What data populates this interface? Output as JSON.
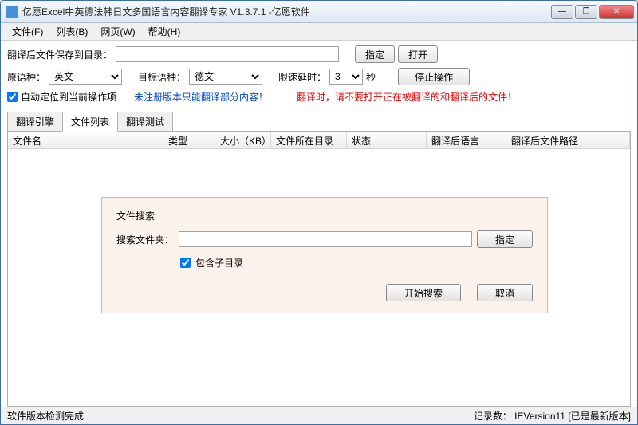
{
  "title": "亿愿Excel中英德法韩日文多国语言内容翻译专家 V1.3.7.1 -亿愿软件",
  "menu": {
    "file": "文件(F)",
    "list": "列表(B)",
    "web": "网页(W)",
    "help": "帮助(H)"
  },
  "saveDir": {
    "label": "翻译后文件保存到目录：",
    "value": "",
    "specify": "指定",
    "open": "打开"
  },
  "lang": {
    "srcLabel": "原语种：",
    "srcValue": "英文",
    "tgtLabel": "目标语种：",
    "tgtValue": "德文",
    "delayLabel": "限速延时：",
    "delayValue": "3",
    "delayUnit": "秒",
    "stop": "停止操作"
  },
  "opts": {
    "autoLocate": "自动定位到当前操作项",
    "unregistered": "未注册版本只能翻译部分内容！",
    "warning": "翻译时，请不要打开正在被翻译的和翻译后的文件！"
  },
  "tabs": {
    "engine": "翻译引擎",
    "filelist": "文件列表",
    "test": "翻译测试"
  },
  "columns": {
    "name": "文件名",
    "type": "类型",
    "size": "大小（KB）",
    "dir": "文件所在目录",
    "status": "状态",
    "lang": "翻译后语言",
    "path": "翻译后文件路径"
  },
  "dialog": {
    "title": "文件搜索",
    "folderLabel": "搜索文件夹：",
    "folderValue": "",
    "specify": "指定",
    "includeSub": "包含子目录",
    "start": "开始搜索",
    "cancel": "取消"
  },
  "status": {
    "left": "软件版本检测完成",
    "right": "记录数：   IEVersion11   [已是最新版本]"
  }
}
